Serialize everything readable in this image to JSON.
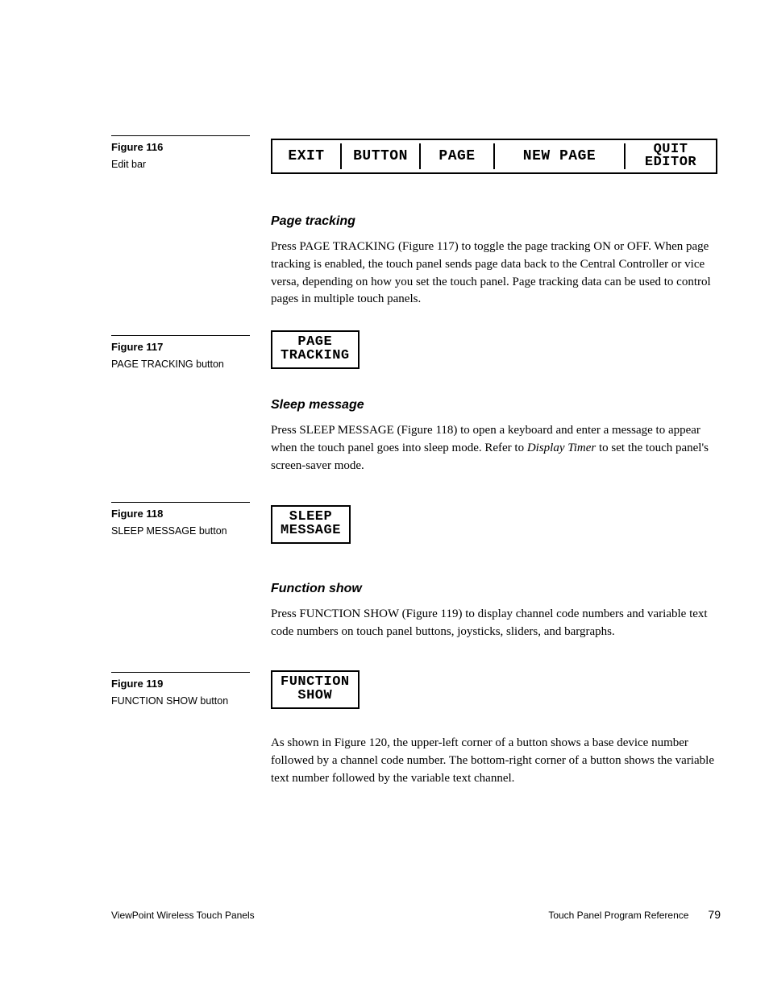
{
  "fig116": {
    "title": "Figure 116",
    "caption": "Edit bar"
  },
  "editbar": {
    "exit": "EXIT",
    "button": "BUTTON",
    "page": "PAGE",
    "newpage": "NEW PAGE",
    "quit1": "QUIT",
    "quit2": "EDITOR"
  },
  "sec1": {
    "heading": "Page tracking",
    "p1": "Press PAGE TRACKING (Figure 117) to toggle the page tracking ON or OFF. When page tracking is enabled, the touch panel sends page data back to the Central Controller or vice versa, depending on how you set the touch panel. Page tracking data can be used to control pages in multiple touch panels."
  },
  "fig117": {
    "title": "Figure 117",
    "caption": "PAGE TRACKING button",
    "btn1": "PAGE",
    "btn2": "TRACKING"
  },
  "sec2": {
    "heading": "Sleep message",
    "p1a": "Press SLEEP MESSAGE (Figure 118) to open a keyboard and enter a message to appear when the touch panel goes into sleep mode. Refer to ",
    "p1i": "Display Timer",
    "p1b": " to set the touch panel's screen-saver mode."
  },
  "fig118": {
    "title": "Figure 118",
    "caption": "SLEEP MESSAGE button",
    "btn1": "SLEEP",
    "btn2": "MESSAGE"
  },
  "sec3": {
    "heading": "Function show",
    "p1": "Press FUNCTION SHOW (Figure 119) to display channel code numbers and variable text code numbers on touch panel buttons, joysticks, sliders, and bargraphs."
  },
  "fig119": {
    "title": "Figure 119",
    "caption": "FUNCTION SHOW button",
    "btn1": "FUNCTION",
    "btn2": "SHOW"
  },
  "sec3b": {
    "p2": "As shown in Figure 120, the upper-left corner of a button shows a base device number followed by a channel code number. The bottom-right corner of a button shows the variable text number followed by the variable text channel."
  },
  "footer": {
    "left": "ViewPoint Wireless Touch Panels",
    "right": "Touch Panel Program Reference",
    "page": "79"
  }
}
